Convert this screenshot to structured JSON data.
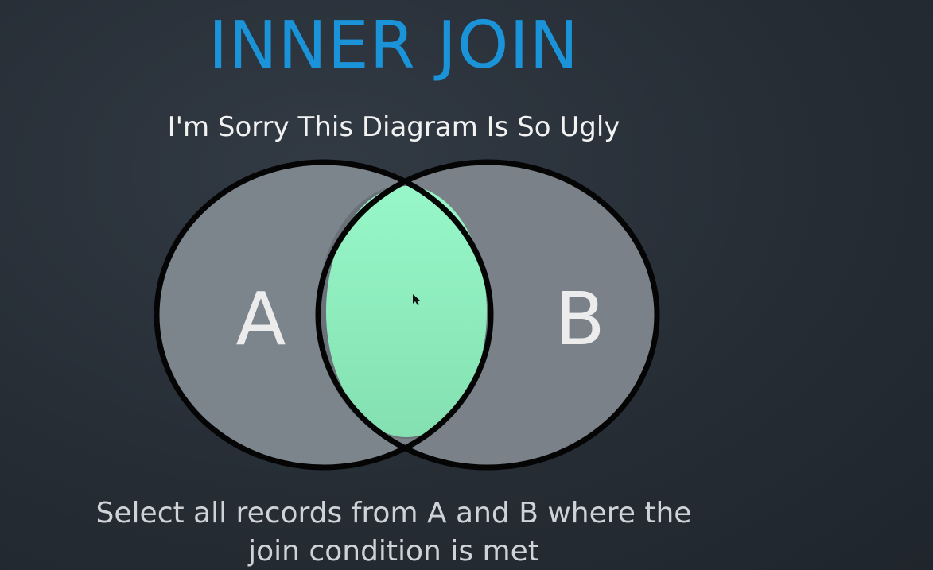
{
  "slide": {
    "title": "INNER JOIN",
    "subtitle": "I'm Sorry This Diagram Is So Ugly",
    "set_a_label": "A",
    "set_b_label": "B",
    "caption_line1": "Select all records from A and B where the",
    "caption_line2": "join condition is met"
  },
  "colors": {
    "title": "#1a93d8",
    "circle_fill": "#7c848c",
    "circle_stroke": "#050505",
    "intersection": "#93f5c4"
  }
}
